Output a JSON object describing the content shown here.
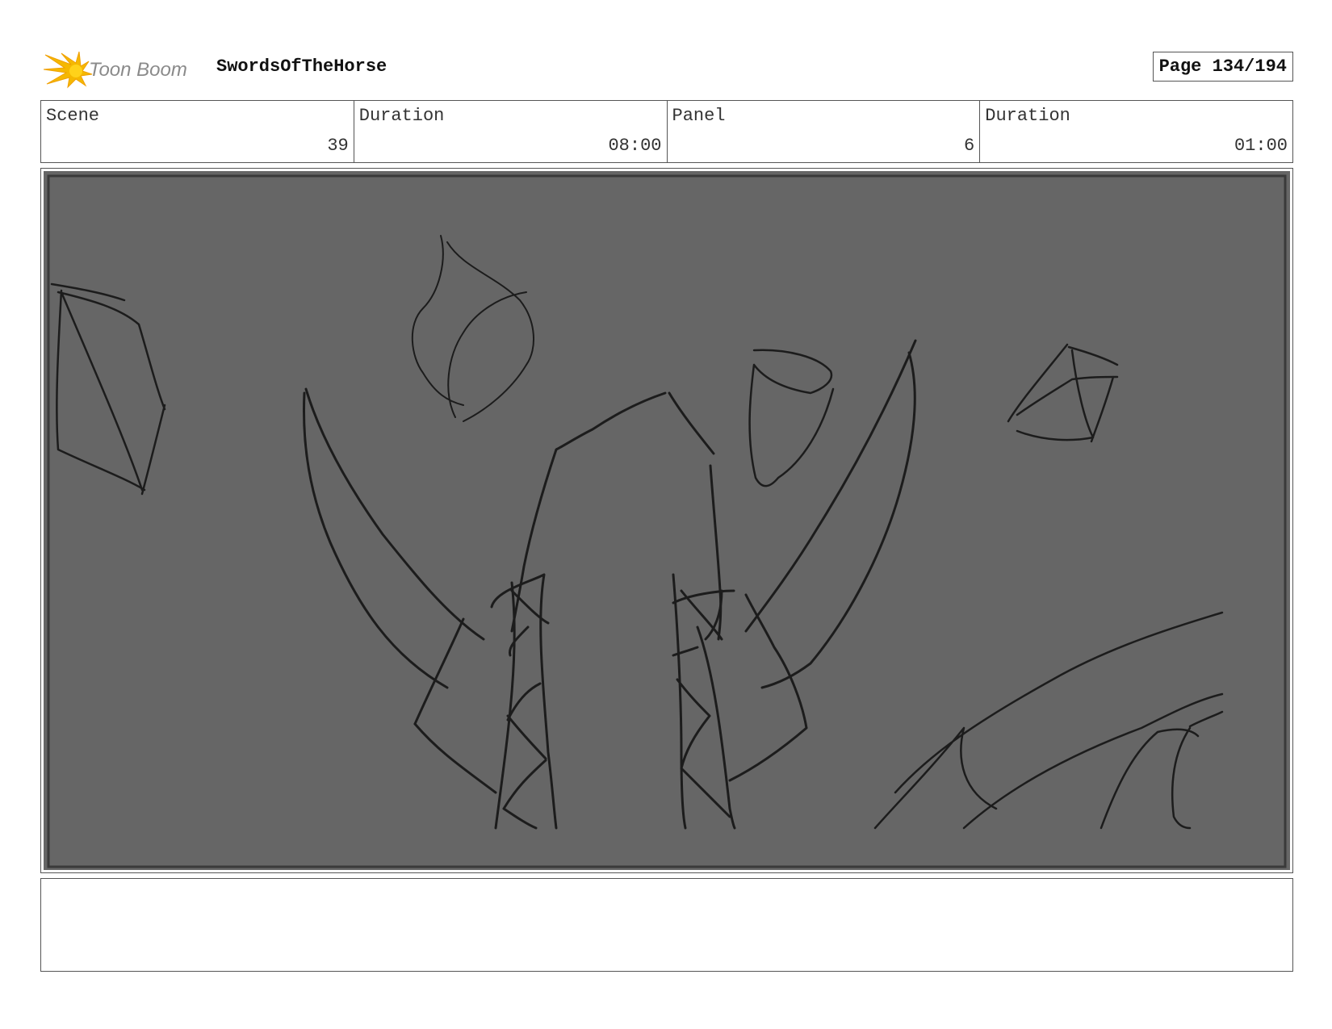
{
  "header": {
    "logo_text": "Toon Boom",
    "project_title": "SwordsOfTheHorse",
    "page_label": "Page 134/194"
  },
  "info": {
    "scene_label": "Scene",
    "scene_value": "39",
    "scene_duration_label": "Duration",
    "scene_duration_value": "08:00",
    "panel_label": "Panel",
    "panel_value": "6",
    "panel_duration_label": "Duration",
    "panel_duration_value": "01:00"
  },
  "colors": {
    "panel_background": "#666666",
    "sketch_stroke": "#1c1c1c",
    "logo_accent": "#f5b800",
    "logo_text": "#8a8a8a"
  },
  "notes": {
    "text": ""
  }
}
